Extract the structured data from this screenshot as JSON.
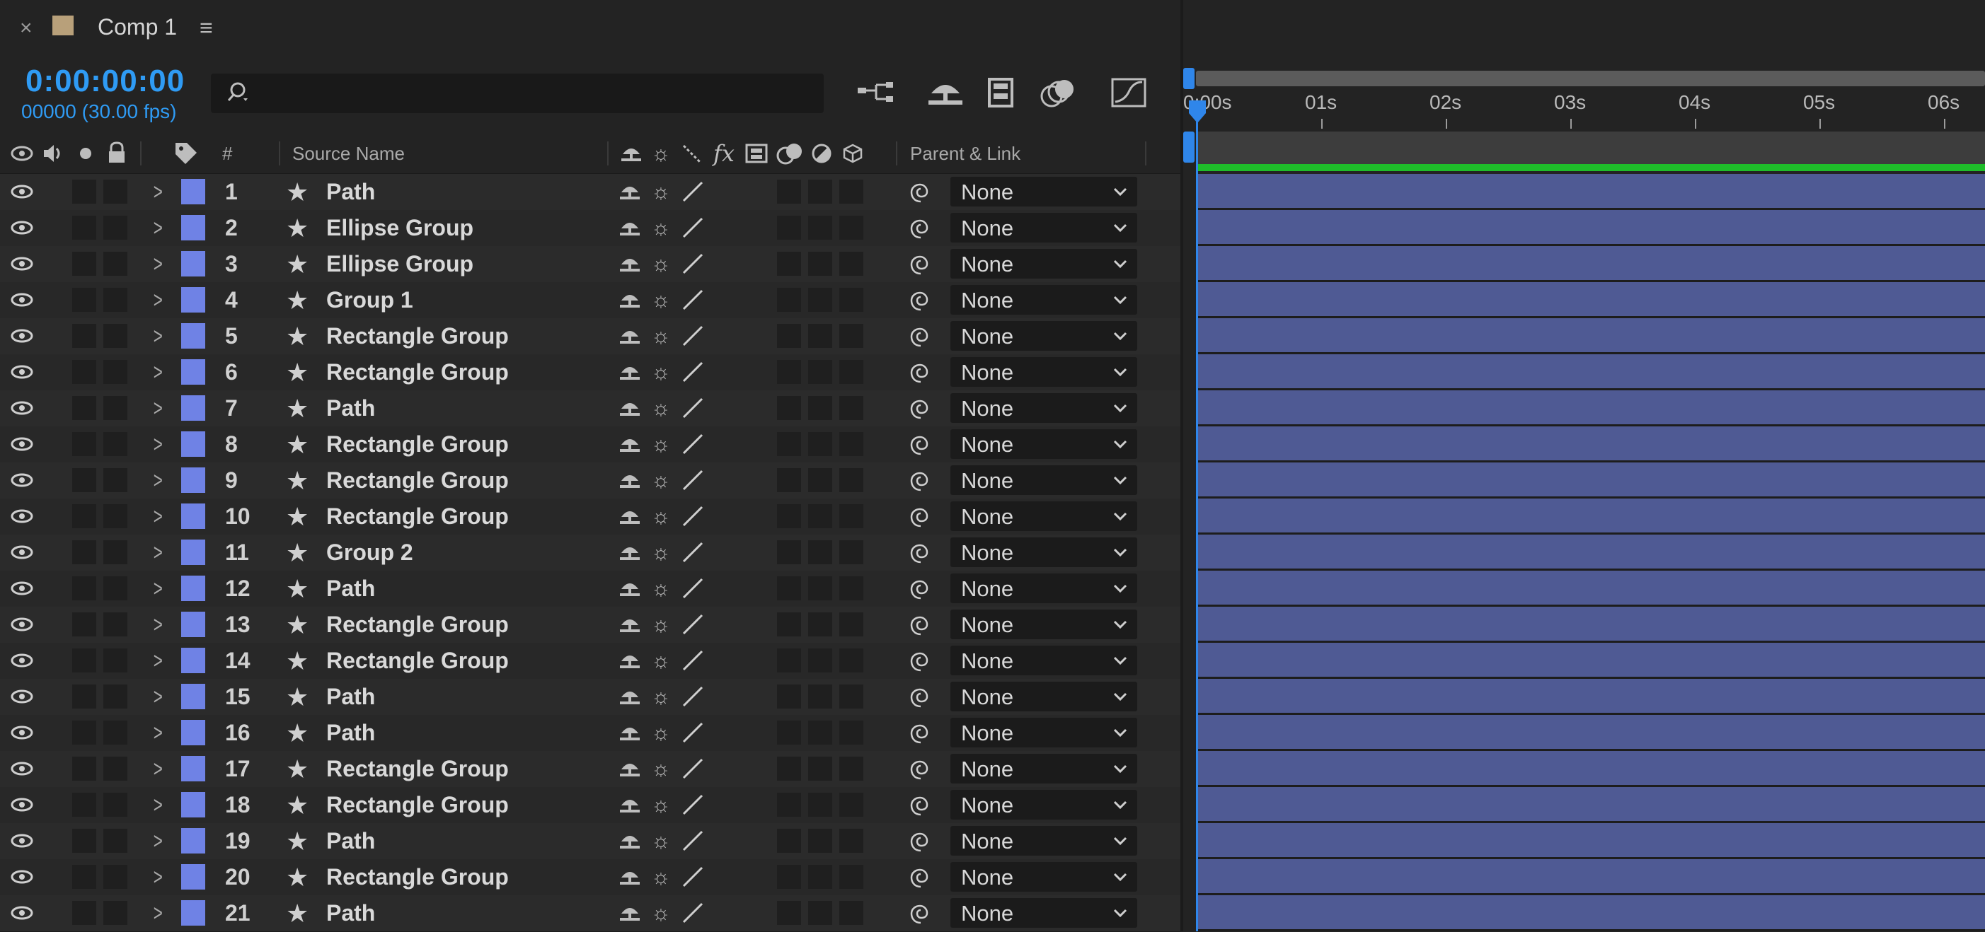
{
  "tab": {
    "close": "×",
    "title": "Comp 1",
    "menu": "≡",
    "swatch_color": "#b8a07a"
  },
  "timecode": {
    "time": "0:00:00:00",
    "frames": "00000 (30.00 fps)"
  },
  "search": {
    "placeholder": ""
  },
  "columns": {
    "num": "#",
    "source_name": "Source Name",
    "parent": "Parent & Link"
  },
  "ruler": {
    "labels": [
      "0:00s",
      "01s",
      "02s",
      "03s",
      "04s",
      "05s",
      "06s"
    ]
  },
  "colors": {
    "accent": "#2f9bf4",
    "label": "#6f82e5",
    "layer_bar": "#4f5a94",
    "work_area_green": "#1fbd2a"
  },
  "layers": [
    {
      "num": "1",
      "name": "Path",
      "parent": "None"
    },
    {
      "num": "2",
      "name": "Ellipse Group",
      "parent": "None"
    },
    {
      "num": "3",
      "name": "Ellipse Group",
      "parent": "None"
    },
    {
      "num": "4",
      "name": "Group 1",
      "parent": "None"
    },
    {
      "num": "5",
      "name": "Rectangle Group",
      "parent": "None"
    },
    {
      "num": "6",
      "name": "Rectangle Group",
      "parent": "None"
    },
    {
      "num": "7",
      "name": "Path",
      "parent": "None"
    },
    {
      "num": "8",
      "name": "Rectangle Group",
      "parent": "None"
    },
    {
      "num": "9",
      "name": "Rectangle Group",
      "parent": "None"
    },
    {
      "num": "10",
      "name": "Rectangle Group",
      "parent": "None"
    },
    {
      "num": "11",
      "name": "Group 2",
      "parent": "None"
    },
    {
      "num": "12",
      "name": "Path",
      "parent": "None"
    },
    {
      "num": "13",
      "name": "Rectangle Group",
      "parent": "None"
    },
    {
      "num": "14",
      "name": "Rectangle Group",
      "parent": "None"
    },
    {
      "num": "15",
      "name": "Path",
      "parent": "None"
    },
    {
      "num": "16",
      "name": "Path",
      "parent": "None"
    },
    {
      "num": "17",
      "name": "Rectangle Group",
      "parent": "None"
    },
    {
      "num": "18",
      "name": "Rectangle Group",
      "parent": "None"
    },
    {
      "num": "19",
      "name": "Path",
      "parent": "None"
    },
    {
      "num": "20",
      "name": "Rectangle Group",
      "parent": "None"
    },
    {
      "num": "21",
      "name": "Path",
      "parent": "None"
    }
  ]
}
